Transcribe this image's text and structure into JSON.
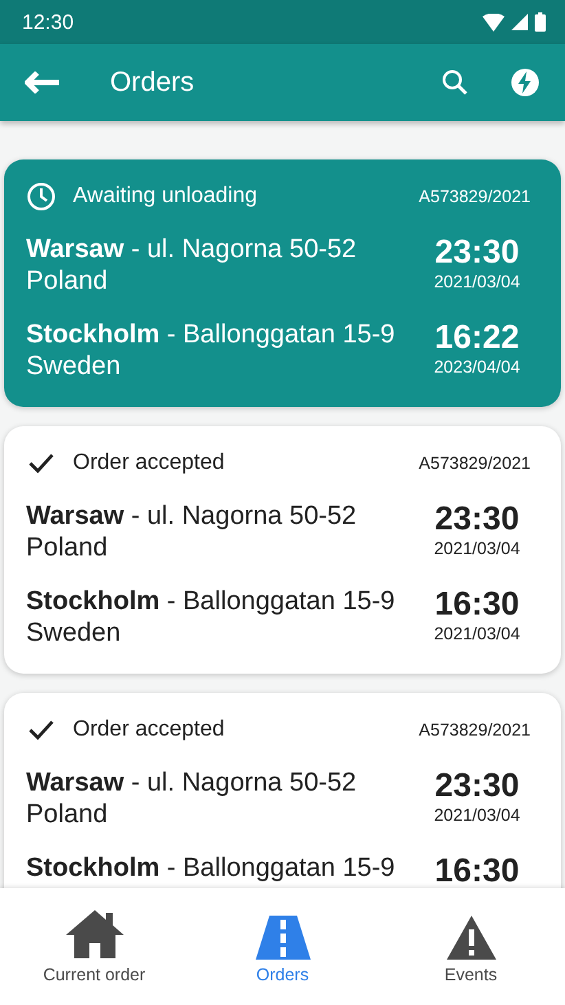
{
  "status_bar": {
    "time": "12:30"
  },
  "app_bar": {
    "title": "Orders"
  },
  "orders": [
    {
      "highlighted": true,
      "kind": "clock",
      "status": "Awaiting unloading",
      "number": "A573829/2021",
      "stops": [
        {
          "address": "**Warsaw** - ul. Nagorna 50-52",
          "country": "Poland",
          "time": "23:30",
          "date": "2021/03/04"
        },
        {
          "address": "**Stockholm** - Ballonggatan 15-9",
          "country": "Sweden",
          "time": "16:22",
          "date": "2023/04/04"
        }
      ]
    },
    {
      "highlighted": false,
      "kind": "check",
      "status": "Order accepted",
      "number": "A573829/2021",
      "stops": [
        {
          "address": "**Warsaw** - ul. Nagorna 50-52",
          "country": "Poland",
          "time": "23:30",
          "date": "2021/03/04"
        },
        {
          "address": "**Stockholm** - Ballonggatan 15-9",
          "country": "Sweden",
          "time": "16:30",
          "date": "2021/03/04"
        }
      ]
    },
    {
      "highlighted": false,
      "kind": "check",
      "status": "Order accepted",
      "number": "A573829/2021",
      "stops": [
        {
          "address": "**Warsaw** - ul. Nagorna 50-52",
          "country": "Poland",
          "time": "23:30",
          "date": "2021/03/04"
        },
        {
          "address": "**Stockholm** - Ballonggatan 15-9",
          "time": "16:30"
        }
      ]
    }
  ],
  "bottom_nav": [
    {
      "kind": "home",
      "label": "Current order",
      "selected": false
    },
    {
      "kind": "road",
      "label": "Orders",
      "selected": true
    },
    {
      "kind": "warning",
      "label": "Events",
      "selected": false
    }
  ]
}
